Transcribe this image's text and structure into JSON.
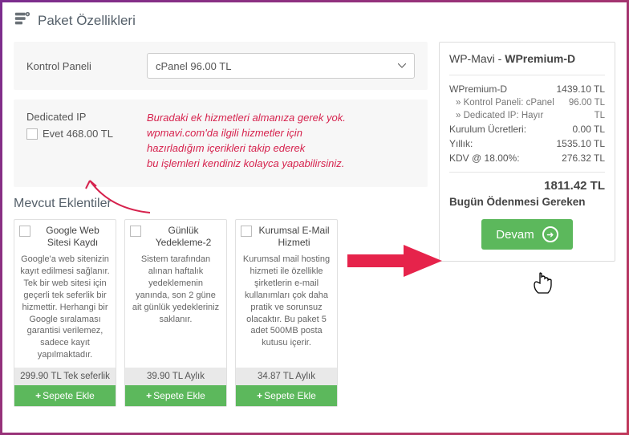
{
  "header": {
    "title": "Paket Özellikleri"
  },
  "kontrol": {
    "label": "Kontrol Paneli",
    "selected": "cPanel 96.00 TL"
  },
  "dedicated": {
    "title": "Dedicated IP",
    "option": "Evet 468.00 TL"
  },
  "annotation": {
    "l1": "Buradaki ek hizmetleri almanıza gerek yok.",
    "l2": "wpmavi.com'da ilgili hizmetler için",
    "l3": "hazırladığım içerikleri takip ederek",
    "l4": "bu işlemleri kendiniz kolayca yapabilirsiniz."
  },
  "mevcut_title": "Mevcut Eklentiler",
  "addons": [
    {
      "name": "Google Web Sitesi Kaydı",
      "desc": "Google'a web sitenizin kayıt edilmesi sağlanır. Tek bir web sitesi için geçerli tek seferlik bir hizmettir. Herhangi bir Google sıralaması garantisi verilemez, sadece kayıt yapılmaktadır.",
      "price": "299.90 TL Tek seferlik",
      "btn": "Sepete Ekle"
    },
    {
      "name": "Günlük Yedekleme-2",
      "desc": "Sistem tarafından alınan haftalık yedeklemenin yanında, son 2 güne ait günlük yedekleriniz saklanır.",
      "price": "39.90 TL Aylık",
      "btn": "Sepete Ekle"
    },
    {
      "name": "Kurumsal E-Mail Hizmeti",
      "desc": "Kurumsal mail hosting hizmeti ile özellikle şirketlerin e-mail kullanımları çok daha pratik ve sorunsuz olacaktır. Bu paket 5 adet 500MB posta kutusu içerir.",
      "price": "34.87 TL Aylık",
      "btn": "Sepete Ekle"
    }
  ],
  "summary": {
    "brand": "WP-Mavi",
    "product": "WPremium-D",
    "rows": {
      "product_name": "WPremium-D",
      "product_price": "1439.10 TL",
      "sub1_label": "» Kontrol Paneli: cPanel",
      "sub1_price": "96.00 TL",
      "sub2_label": "» Dedicated IP: Hayır",
      "sub2_price": "TL",
      "setup_label": "Kurulum Ücretleri:",
      "setup_price": "0.00 TL",
      "yearly_label": "Yıllık:",
      "yearly_price": "1535.10 TL",
      "vat_label": "KDV @ 18.00%:",
      "vat_price": "276.32 TL"
    },
    "total": "1811.42 TL",
    "due_label": "Bugün Ödenmesi Gereken"
  },
  "devam_label": "Devam"
}
